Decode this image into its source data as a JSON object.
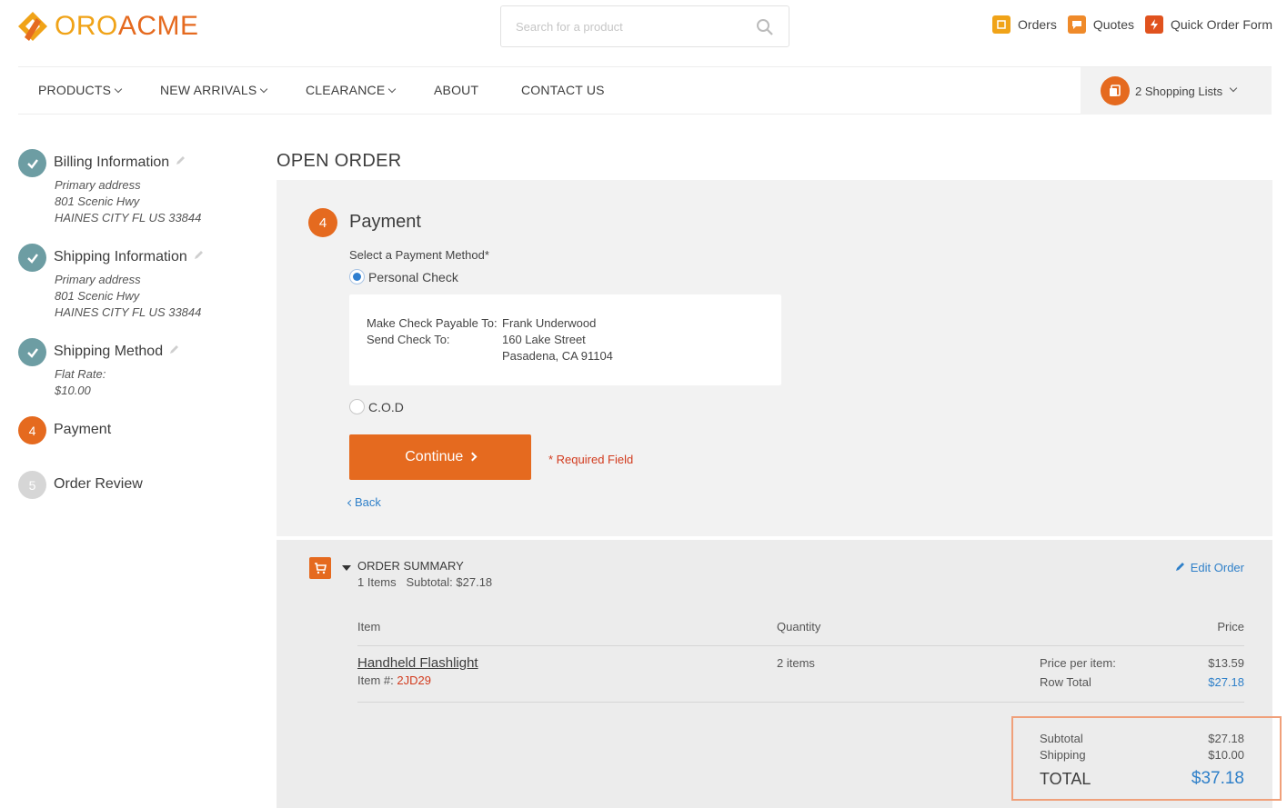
{
  "brand": {
    "name_part1": "ORO",
    "name_part2": "ACME"
  },
  "search": {
    "placeholder": "Search for a product"
  },
  "top_links": [
    {
      "label": "Orders",
      "icon": "orders-icon"
    },
    {
      "label": "Quotes",
      "icon": "quotes-icon"
    },
    {
      "label": "Quick Order Form",
      "icon": "quick-order-icon"
    }
  ],
  "nav": {
    "items": [
      "PRODUCTS",
      "NEW ARRIVALS",
      "CLEARANCE",
      "ABOUT",
      "CONTACT US"
    ],
    "shopping_lists": "2 Shopping Lists"
  },
  "steps": [
    {
      "num": "",
      "title": "Billing Information",
      "details": [
        "Primary address",
        "801 Scenic Hwy",
        "HAINES CITY FL US 33844"
      ]
    },
    {
      "num": "",
      "title": "Shipping Information",
      "details": [
        "Primary address",
        "801 Scenic Hwy",
        "HAINES CITY FL US 33844"
      ]
    },
    {
      "num": "",
      "title": "Shipping Method",
      "details": [
        "Flat Rate:",
        "$10.00"
      ]
    },
    {
      "num": "4",
      "title": "Payment"
    },
    {
      "num": "5",
      "title": "Order Review"
    }
  ],
  "page_title": "OPEN ORDER",
  "payment": {
    "step_num": "4",
    "title": "Payment",
    "method_label": "Select a Payment Method*",
    "options": [
      "Personal Check",
      "C.O.D"
    ],
    "selected": "Personal Check",
    "check_info": {
      "payable_label": "Make Check Payable To:",
      "payable_value": "Frank Underwood",
      "send_label": "Send Check To:",
      "address_line1": "160 Lake Street",
      "address_line2": "Pasadena, CA 91104"
    },
    "continue_label": "Continue",
    "required_note": "* Required Field",
    "back_label": "Back"
  },
  "summary": {
    "title": "ORDER SUMMARY",
    "items_count": "1 Items",
    "subtotal_text": "Subtotal: $27.18",
    "edit_label": "Edit Order",
    "columns": {
      "item": "Item",
      "quantity": "Quantity",
      "price": "Price"
    },
    "rows": [
      {
        "name": "Handheld Flashlight",
        "sku_label": "Item #:",
        "sku": "2JD29",
        "quantity": "2 items",
        "price_label": "Price per item:",
        "price": "$13.59",
        "row_total_label": "Row Total",
        "row_total": "$27.18"
      }
    ],
    "totals": {
      "subtotal_label": "Subtotal",
      "subtotal": "$27.18",
      "shipping_label": "Shipping",
      "shipping": "$10.00",
      "total_label": "TOTAL",
      "total": "$37.18"
    }
  },
  "colors": {
    "accent": "#e56a1f",
    "brand_yellow": "#f0a318",
    "link": "#2f80c9",
    "step_done": "#6d9da3"
  }
}
